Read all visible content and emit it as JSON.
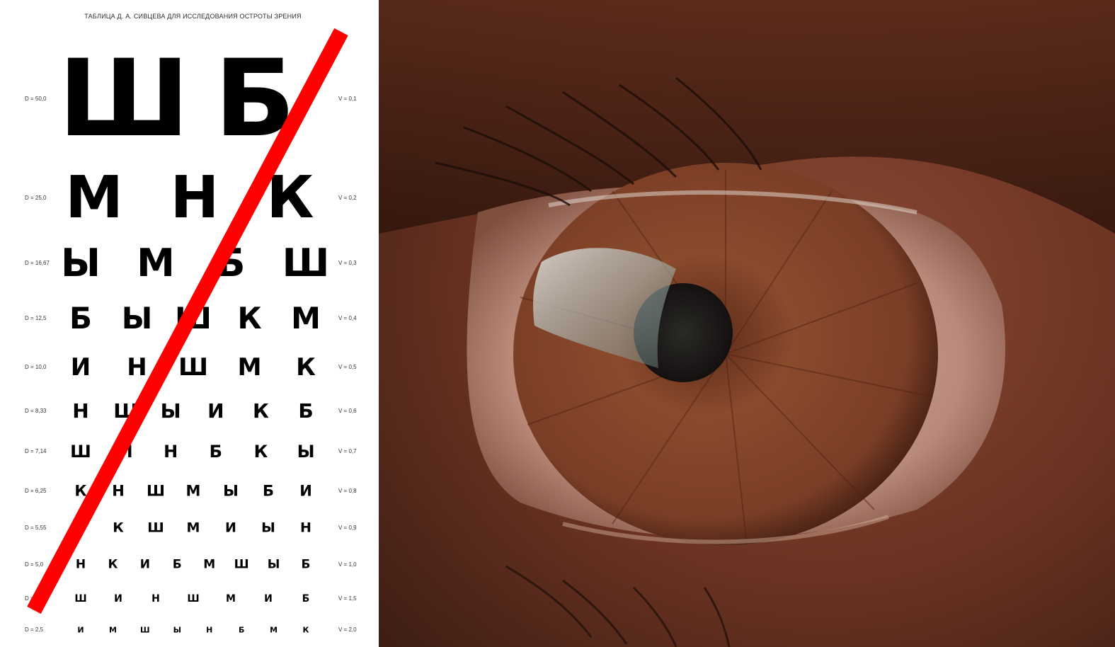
{
  "eye_chart": {
    "title": "ТАБЛИЦА Д. А. СИВЦЕВА ДЛЯ ИССЛЕДОВАНИЯ ОСТРОТЫ ЗРЕНИЯ",
    "rows": [
      {
        "d": "D = 50,0",
        "v": "V = 0,1",
        "letters": [
          "Ш",
          "Б"
        ]
      },
      {
        "d": "D = 25,0",
        "v": "V = 0,2",
        "letters": [
          "М",
          "Н",
          "К"
        ]
      },
      {
        "d": "D = 16,67",
        "v": "V = 0,3",
        "letters": [
          "Ы",
          "М",
          "Б",
          "Ш"
        ]
      },
      {
        "d": "D = 12,5",
        "v": "V = 0,4",
        "letters": [
          "Б",
          "Ы",
          "Ш",
          "К",
          "М"
        ]
      },
      {
        "d": "D = 10,0",
        "v": "V = 0,5",
        "letters": [
          "И",
          "Н",
          "Ш",
          "М",
          "К"
        ]
      },
      {
        "d": "D = 8,33",
        "v": "V = 0,6",
        "letters": [
          "Н",
          "Ш",
          "Ы",
          "И",
          "К",
          "Б"
        ]
      },
      {
        "d": "D = 7,14",
        "v": "V = 0,7",
        "letters": [
          "Ш",
          "И",
          "Н",
          "Б",
          "К",
          "Ы"
        ]
      },
      {
        "d": "D = 6,25",
        "v": "V = 0,8",
        "letters": [
          "К",
          "Н",
          "Ш",
          "М",
          "Ы",
          "Б",
          "И"
        ]
      },
      {
        "d": "D = 5,55",
        "v": "V = 0,9",
        "letters": [
          "Б",
          "К",
          "Ш",
          "М",
          "И",
          "Ы",
          "Н"
        ]
      },
      {
        "d": "D = 5,0",
        "v": "V = 1,0",
        "letters": [
          "Н",
          "К",
          "И",
          "Б",
          "М",
          "Ш",
          "Ы",
          "Б"
        ]
      },
      {
        "d": "D = 3,33",
        "v": "V = 1,5",
        "letters": [
          "Ш",
          "И",
          "Н",
          "Ш",
          "М",
          "И",
          "Б"
        ]
      },
      {
        "d": "D = 2,5",
        "v": "V = 2,0",
        "letters": [
          "И",
          "М",
          "Ш",
          "Ы",
          "Н",
          "Б",
          "М",
          "К"
        ]
      }
    ],
    "strike_color": "#ff0000"
  },
  "photo": {
    "subject": "eye-closeup",
    "iris_color": "#7a3e26",
    "skin_color": "#6b3322",
    "pupil_color": "#1a1410"
  }
}
